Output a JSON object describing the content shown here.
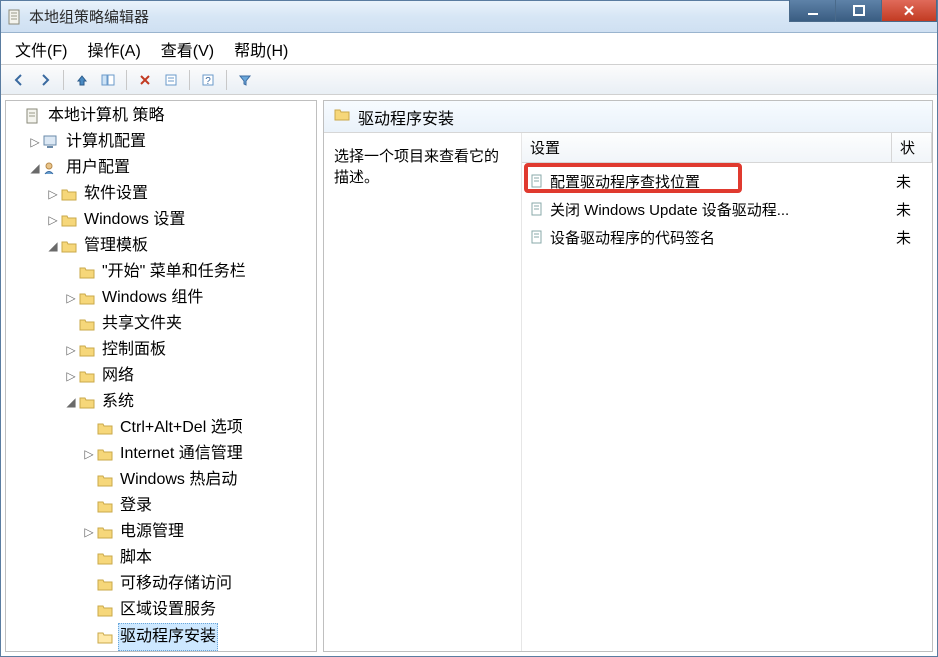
{
  "window": {
    "title": "本地组策略编辑器"
  },
  "menu": {
    "file": "文件(F)",
    "action": "操作(A)",
    "view": "查看(V)",
    "help": "帮助(H)"
  },
  "toolbar": {
    "back": "back",
    "forward": "forward",
    "up": "up",
    "refresh": "refresh",
    "export": "export",
    "help": "help",
    "props": "properties",
    "filter": "filter"
  },
  "tree": {
    "root": "本地计算机 策略",
    "computer_config": "计算机配置",
    "user_config": "用户配置",
    "software_settings": "软件设置",
    "windows_settings": "Windows 设置",
    "admin_templates": "管理模板",
    "start_taskbar": "\"开始\" 菜单和任务栏",
    "windows_components": "Windows 组件",
    "shared_folders": "共享文件夹",
    "control_panel": "控制面板",
    "network": "网络",
    "system": "系统",
    "ctrl_alt_del": "Ctrl+Alt+Del 选项",
    "internet_comm": "Internet 通信管理",
    "windows_hot_start": "Windows 热启动",
    "logon": "登录",
    "power_mgmt": "电源管理",
    "scripts": "脚本",
    "removable_storage": "可移动存储访问",
    "locale_services": "区域设置服务",
    "driver_install": "驱动程序安装"
  },
  "detail": {
    "header": "驱动程序安装",
    "desc_prompt": "选择一个项目来查看它的描述。",
    "columns": {
      "setting": "设置",
      "status": "状"
    },
    "rows": [
      {
        "label": "配置驱动程序查找位置",
        "status": "未"
      },
      {
        "label": "关闭 Windows Update 设备驱动程...",
        "status": "未"
      },
      {
        "label": "设备驱动程序的代码签名",
        "status": "未"
      }
    ]
  }
}
